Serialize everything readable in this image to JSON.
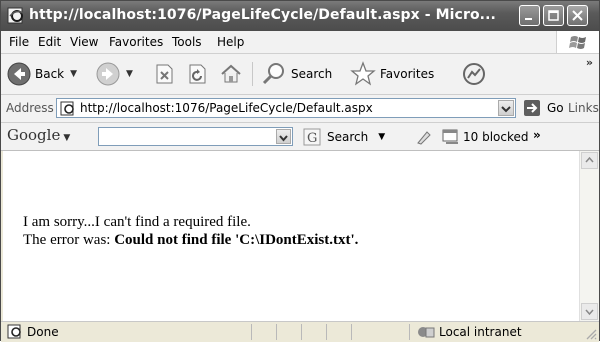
{
  "window": {
    "title": "http://localhost:1076/PageLifeCycle/Default.aspx - Micro..."
  },
  "menu": {
    "items": [
      "File",
      "Edit",
      "View",
      "Favorites",
      "Tools",
      "Help"
    ]
  },
  "toolbar": {
    "back_label": "Back",
    "search_label": "Search",
    "favorites_label": "Favorites",
    "more_label": "»"
  },
  "address": {
    "label": "Address",
    "url": "http://localhost:1076/PageLifeCycle/Default.aspx",
    "go_label": "Go",
    "links_label": "Links"
  },
  "google": {
    "logo": "Google",
    "search_value": "",
    "search_label": "Search",
    "blocked_label": "10 blocked",
    "more_label": "»"
  },
  "content": {
    "line1": "I am sorry...I can't find a required file.",
    "line2_prefix": "The error was: ",
    "line2_error": "Could not find file 'C:\\IDontExist.txt'."
  },
  "status": {
    "text": "Done",
    "zone": "Local intranet"
  }
}
